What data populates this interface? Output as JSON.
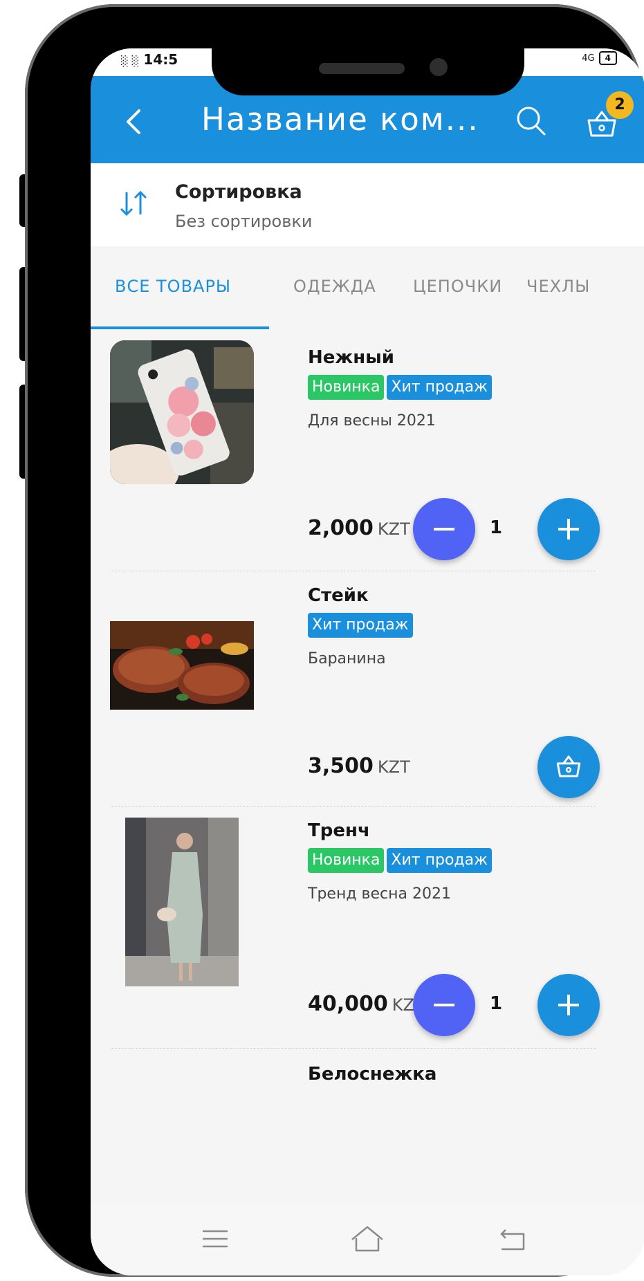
{
  "status": {
    "time": "14:5",
    "signal": "░ ░",
    "network": "4G",
    "battery": "4"
  },
  "appbar": {
    "title": "Название ком...",
    "cart_count": "2"
  },
  "sort": {
    "title": "Сортировка",
    "value": "Без сортировки"
  },
  "tabs": [
    "ВСЕ ТОВАРЫ",
    "ОДЕЖДА",
    "ЦЕПОЧКИ",
    "ЧЕХЛЫ"
  ],
  "active_tab": "ВСЕ ТОВАРЫ",
  "currency": "KZT",
  "products": [
    {
      "name": "Нежный",
      "badges": [
        "Новинка",
        "Хит продаж"
      ],
      "description": "Для весны 2021",
      "price": "2,000",
      "quantity": "1"
    },
    {
      "name": "Стейк",
      "badges": [
        "Хит продаж"
      ],
      "description": "Баранина",
      "price": "3,500"
    },
    {
      "name": "Тренч",
      "badges": [
        "Новинка",
        "Хит продаж"
      ],
      "description": "Тренд весна 2021",
      "price": "40,000",
      "quantity": "1"
    },
    {
      "name": "Белоснежка"
    }
  ],
  "colors": {
    "primary": "#1a8fdb",
    "badge_new": "#2bc766",
    "minus_button": "#5063f5",
    "cart_badge": "#f3b81f"
  },
  "icons": [
    "back-icon",
    "search-icon",
    "cart-icon",
    "sort-icon",
    "basket-icon",
    "menu-icon",
    "home-icon",
    "back-nav-icon"
  ]
}
